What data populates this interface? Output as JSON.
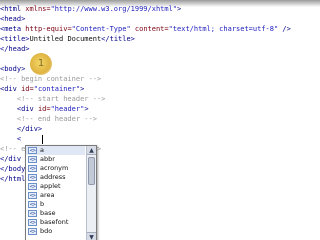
{
  "editor": {
    "lines": [
      {
        "segments": [
          {
            "cls": "tag",
            "text": "<html "
          },
          {
            "cls": "attr",
            "text": "xmlns="
          },
          {
            "cls": "val",
            "text": "\"http://www.w3.org/1999/xhtml\""
          },
          {
            "cls": "tag",
            "text": ">"
          }
        ]
      },
      {
        "segments": [
          {
            "cls": "tag",
            "text": "<head>"
          }
        ]
      },
      {
        "segments": [
          {
            "cls": "tag",
            "text": "<meta "
          },
          {
            "cls": "attr",
            "text": "http-equiv="
          },
          {
            "cls": "val",
            "text": "\"Content-Type\""
          },
          {
            "cls": "attr",
            "text": " content="
          },
          {
            "cls": "val",
            "text": "\"text/html; charset=utf-8\""
          },
          {
            "cls": "tag",
            "text": " />"
          }
        ]
      },
      {
        "segments": [
          {
            "cls": "tag",
            "text": "<title>"
          },
          {
            "cls": "text",
            "text": "Untitled Document"
          },
          {
            "cls": "tag",
            "text": "</title>"
          }
        ]
      },
      {
        "segments": [
          {
            "cls": "tag",
            "text": "</head>"
          }
        ]
      },
      {
        "segments": []
      },
      {
        "segments": [
          {
            "cls": "tag",
            "text": "<body>"
          }
        ]
      },
      {
        "segments": [
          {
            "cls": "cmt",
            "text": "<!-- begin container -->"
          }
        ]
      },
      {
        "segments": [
          {
            "cls": "tag",
            "text": "<div "
          },
          {
            "cls": "attr",
            "text": "id="
          },
          {
            "cls": "val",
            "text": "\"container\""
          },
          {
            "cls": "tag",
            "text": ">"
          }
        ]
      },
      {
        "segments": [
          {
            "cls": "cmt",
            "text": "    <!-- start header -->"
          }
        ]
      },
      {
        "segments": [
          {
            "cls": "tag",
            "text": "    <div "
          },
          {
            "cls": "attr",
            "text": "id="
          },
          {
            "cls": "val",
            "text": "\"header\""
          },
          {
            "cls": "tag",
            "text": ">"
          }
        ]
      },
      {
        "segments": [
          {
            "cls": "cmt",
            "text": "    <!-- end header -->"
          }
        ]
      },
      {
        "segments": [
          {
            "cls": "tag",
            "text": "    </div>"
          }
        ]
      },
      {
        "segments": [
          {
            "cls": "tag",
            "text": "    <"
          }
        ]
      },
      {
        "segments": [
          {
            "cls": "cmt",
            "text": "<!-- e"
          },
          {
            "cls": "cmt",
            "text": "             r -->"
          }
        ]
      },
      {
        "segments": [
          {
            "cls": "tag",
            "text": "</div"
          }
        ]
      },
      {
        "segments": [
          {
            "cls": "tag",
            "text": "</body"
          }
        ]
      },
      {
        "segments": [
          {
            "cls": "tag",
            "text": "</html"
          }
        ]
      }
    ]
  },
  "cursor_marker": {
    "label": "1"
  },
  "autocomplete": {
    "selected_index": 0,
    "items": [
      {
        "label": "a",
        "icon": "tag-icon",
        "glyph": "<>"
      },
      {
        "label": "abbr",
        "icon": "tag-icon",
        "glyph": "<>"
      },
      {
        "label": "acronym",
        "icon": "tag-icon",
        "glyph": "<>"
      },
      {
        "label": "address",
        "icon": "tag-icon",
        "glyph": "<>"
      },
      {
        "label": "applet",
        "icon": "tag-icon",
        "glyph": "<>"
      },
      {
        "label": "area",
        "icon": "tag-icon",
        "glyph": "<>"
      },
      {
        "label": "b",
        "icon": "tag-icon",
        "glyph": "<>"
      },
      {
        "label": "base",
        "icon": "tag-icon",
        "glyph": "<>"
      },
      {
        "label": "basefont",
        "icon": "tag-icon",
        "glyph": "<>"
      },
      {
        "label": "bdo",
        "icon": "tag-icon",
        "glyph": "<>"
      }
    ],
    "scrollbar": {
      "up_glyph": "▲",
      "down_glyph": "▼"
    }
  }
}
